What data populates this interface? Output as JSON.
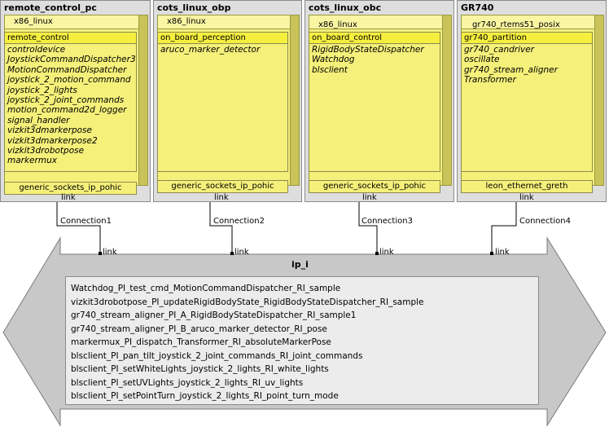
{
  "nodes": [
    {
      "name": "remote_control_pc",
      "platform": "x86_linux",
      "partition": "remote_control",
      "functions": [
        "controldevice",
        "JoystickCommandDispatcher3",
        "MotionCommandDispatcher",
        "joystick_2_motion_command",
        "joystick_2_lights",
        "joystick_2_joint_commands",
        "motion_command2d_logger",
        "signal_handler",
        "vizkit3dmarkerpose",
        "vizkit3dmarkerpose2",
        "vizkit3drobotpose",
        "markermux"
      ],
      "interface": "generic_sockets_ip_pohic",
      "port_label": "link"
    },
    {
      "name": "cots_linux_obp",
      "platform": "x86_linux",
      "partition": "on_board_perception",
      "functions": [
        "aruco_marker_detector"
      ],
      "interface": "generic_sockets_ip_pohic",
      "port_label": "link"
    },
    {
      "name": "cots_linux_obc",
      "platform": "x86_linux",
      "partition": "on_board_control",
      "functions": [
        "RigidBodyStateDispatcher",
        "Watchdog",
        "blsclient"
      ],
      "interface": "generic_sockets_ip_pohic",
      "port_label": "link"
    },
    {
      "name": "GR740",
      "platform": "gr740_rtems51_posix",
      "partition": "gr740_partition",
      "functions": [
        "gr740_candriver",
        "oscillate",
        "gr740_stream_aligner",
        "Transformer"
      ],
      "interface": "leon_ethernet_greth",
      "port_label": "link"
    }
  ],
  "connections": [
    "Connection1",
    "Connection2",
    "Connection3",
    "Connection4"
  ],
  "bus": {
    "name": "ip_i",
    "port_label": "link",
    "signals": [
      "Watchdog_PI_test_cmd_MotionCommandDispatcher_RI_sample",
      "vizkit3drobotpose_PI_updateRigidBodyState_RigidBodyStateDispatcher_RI_sample",
      "gr740_stream_aligner_PI_A_RigidBodyStateDispatcher_RI_sample1",
      "gr740_stream_aligner_PI_B_aruco_marker_detector_RI_pose",
      "markermux_PI_dispatch_Transformer_RI_absoluteMarkerPose",
      "blsclient_PI_pan_tilt_joystick_2_joint_commands_RI_joint_commands",
      "blsclient_PI_setWhiteLights_joystick_2_lights_RI_white_lights",
      "blsclient_PI_setUVLights_joystick_2_lights_RI_uv_lights",
      "blsclient_PI_setPointTurn_joystick_2_lights_RI_point_turn_mode"
    ]
  },
  "colors": {
    "node_bg": "#dedede",
    "cube_face": "#f5f07a",
    "partition_header": "#f5ef40",
    "bus_fill": "#c8c8c8",
    "signal_panel": "#ececec"
  }
}
